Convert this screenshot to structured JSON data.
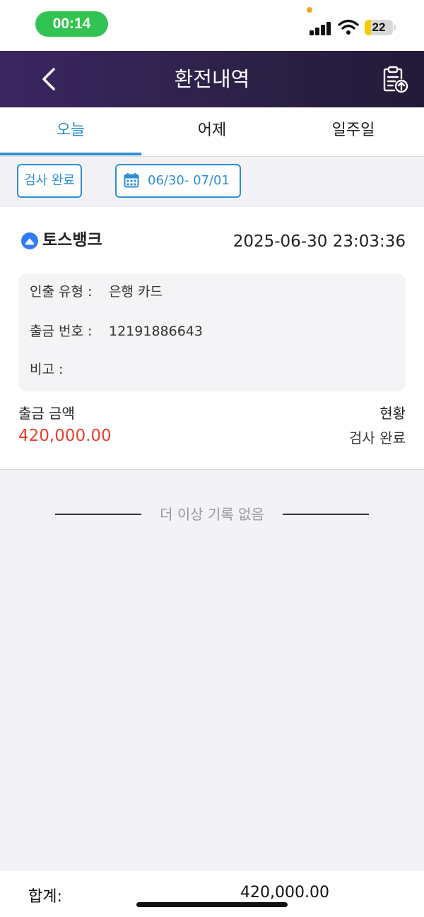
{
  "status_bar": {
    "time": "00:14",
    "battery": "22",
    "battery_level_percent": 22,
    "time_pill_color": "#31c452",
    "battery_color": "#f5cc00"
  },
  "header": {
    "title": "환전내역",
    "back_icon": "chevron-left-icon",
    "export_icon": "clipboard-upload-icon"
  },
  "tabs": [
    {
      "label": "오늘",
      "active": true
    },
    {
      "label": "어제",
      "active": false
    },
    {
      "label": "일주일",
      "active": false
    }
  ],
  "filters": {
    "status": "검사 완료",
    "date_range": "06/30- 07/01",
    "date_icon": "calendar-icon"
  },
  "record": {
    "bank_name": "토스뱅크",
    "bank_icon": "toss-bank-logo-icon",
    "datetime": "2025-06-30 23:03:36",
    "withdraw_type_label": "인출 유형 :",
    "withdraw_type_value": "은행 카드",
    "withdraw_no_label": "출금 번호 :",
    "withdraw_no_value": "12191886643",
    "note_label": "비고 :",
    "note_value": "",
    "amount_label": "출금 금액",
    "amount_value": "420,000.00",
    "state_label": "현황",
    "state_value": "검사 완료"
  },
  "list_end_text": "더 이상 기록 없음",
  "footer": {
    "total_label": "합계:",
    "total_value": "420,000.00"
  },
  "colors": {
    "accent": "#2d8fd5",
    "header_gradient": [
      "#3b2662",
      "#231a38"
    ],
    "amount": "#e8402f"
  }
}
